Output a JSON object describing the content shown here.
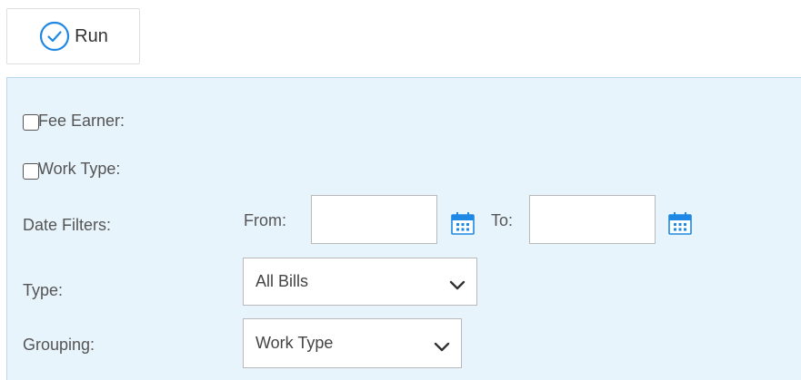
{
  "toolbar": {
    "run_label": "Run"
  },
  "filters": {
    "fee_earner_label": "Fee Earner:",
    "work_type_label": "Work Type:",
    "date_filters_label": "Date Filters:",
    "from_label": "From:",
    "to_label": "To:",
    "from_value": "",
    "to_value": "",
    "type_label": "Type:",
    "type_selected": "All Bills",
    "grouping_label": "Grouping:",
    "grouping_selected": "Work Type"
  },
  "colors": {
    "accent": "#1e88e5",
    "panel_bg": "#e8f4fc"
  }
}
